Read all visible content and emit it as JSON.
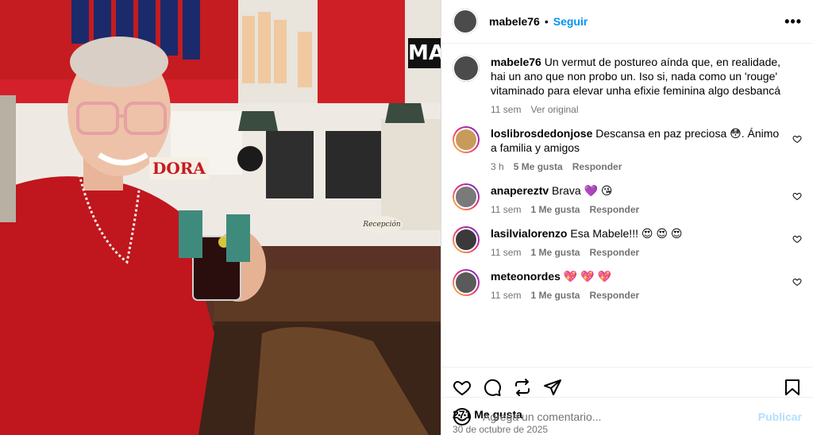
{
  "post": {
    "username": "mabele76",
    "follow_label": "Seguir",
    "more_label": "•••",
    "caption": {
      "username": "mabele76",
      "text": "Un vermut de postureo aínda que, en realidade, hai un ano que non probo un. Iso si, nada como un 'rouge' vitaminado para elevar unha efixie feminina algo desbancá",
      "time": "11 sem",
      "see_translation": "Ver original"
    },
    "photo_signs": {
      "top_sign": "MA",
      "bottom_sign": "Recepción",
      "door_sign": "DORA"
    }
  },
  "comments": [
    {
      "username": "loslibrosdedonjose",
      "text": "Descansa en paz preciosa 😳. Ánimo a familia y amigos",
      "time": "3 h",
      "likes": "5 Me gusta",
      "reply": "Responder"
    },
    {
      "username": "anapereztv",
      "text": "Brava 💜 😘",
      "time": "11 sem",
      "likes": "1 Me gusta",
      "reply": "Responder"
    },
    {
      "username": "lasilvialorenzo",
      "text": "Esa Mabele!!! 😍 😍 😍",
      "time": "11 sem",
      "likes": "1 Me gusta",
      "reply": "Responder"
    },
    {
      "username": "meteonordes",
      "text": "💖 💖 💖",
      "time": "11 sem",
      "likes": "1 Me gusta",
      "reply": "Responder"
    }
  ],
  "stats": {
    "likes": "271 Me gusta",
    "date": "30 de octubre de 2025"
  },
  "composer": {
    "placeholder": "Agrega un comentario...",
    "publish_label": "Publicar"
  },
  "colors": {
    "accent_blue": "#0095f6",
    "publish_disabled": "#b2dffc",
    "muted": "#737373"
  }
}
